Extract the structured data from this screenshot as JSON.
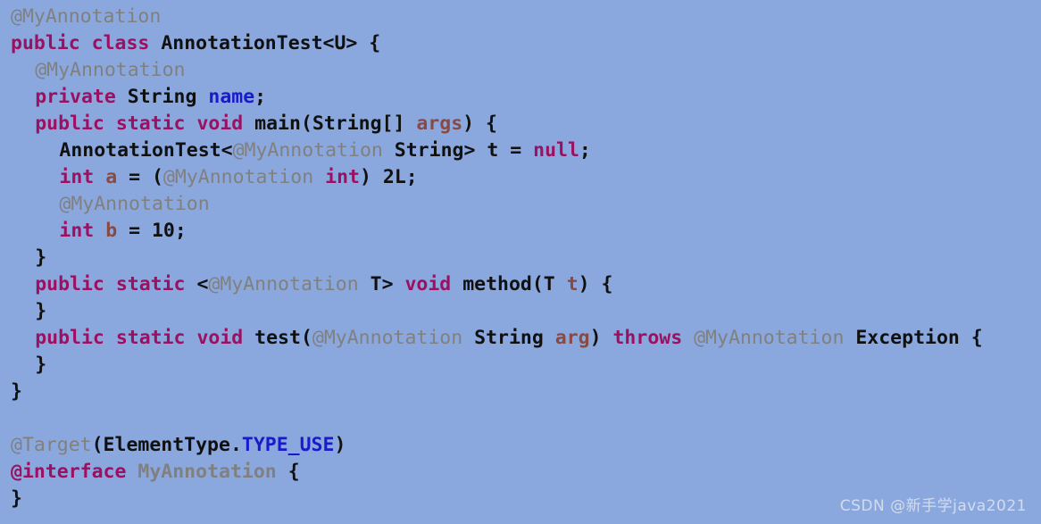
{
  "editor": {
    "background_color": "#8aa8dd",
    "language": "Java",
    "colors": {
      "keyword": "#9b1060",
      "annotation": "#808080",
      "field": "#1a1acc",
      "parameter": "#8a4a44",
      "text": "#101010",
      "constant": "#1a1acc"
    },
    "lines": [
      {
        "indent": 0,
        "tokens": [
          {
            "t": "@MyAnnotation",
            "c": "ann"
          }
        ]
      },
      {
        "indent": 0,
        "tokens": [
          {
            "t": "public",
            "c": "kw"
          },
          {
            "t": " ",
            "c": "plain"
          },
          {
            "t": "class",
            "c": "kw"
          },
          {
            "t": " ",
            "c": "plain"
          },
          {
            "t": "AnnotationTest<U> {",
            "c": "plain"
          }
        ]
      },
      {
        "indent": 1,
        "tokens": [
          {
            "t": "@MyAnnotation",
            "c": "ann"
          }
        ]
      },
      {
        "indent": 1,
        "tokens": [
          {
            "t": "private",
            "c": "kw"
          },
          {
            "t": " ",
            "c": "plain"
          },
          {
            "t": "String",
            "c": "plain"
          },
          {
            "t": " ",
            "c": "plain"
          },
          {
            "t": "name",
            "c": "field"
          },
          {
            "t": ";",
            "c": "plain"
          }
        ]
      },
      {
        "indent": 1,
        "tokens": [
          {
            "t": "public",
            "c": "kw"
          },
          {
            "t": " ",
            "c": "plain"
          },
          {
            "t": "static",
            "c": "kw"
          },
          {
            "t": " ",
            "c": "plain"
          },
          {
            "t": "void",
            "c": "kw"
          },
          {
            "t": " ",
            "c": "plain"
          },
          {
            "t": "main(String[] ",
            "c": "plain"
          },
          {
            "t": "args",
            "c": "param"
          },
          {
            "t": ") {",
            "c": "plain"
          }
        ]
      },
      {
        "indent": 2,
        "tokens": [
          {
            "t": "AnnotationTest<",
            "c": "plain"
          },
          {
            "t": "@MyAnnotation",
            "c": "ann"
          },
          {
            "t": " ",
            "c": "plain"
          },
          {
            "t": "String> t = ",
            "c": "plain"
          },
          {
            "t": "null",
            "c": "kw"
          },
          {
            "t": ";",
            "c": "plain"
          }
        ]
      },
      {
        "indent": 2,
        "tokens": [
          {
            "t": "int",
            "c": "kw"
          },
          {
            "t": " ",
            "c": "plain"
          },
          {
            "t": "a",
            "c": "param"
          },
          {
            "t": " = (",
            "c": "plain"
          },
          {
            "t": "@MyAnnotation",
            "c": "ann"
          },
          {
            "t": " ",
            "c": "plain"
          },
          {
            "t": "int",
            "c": "kw"
          },
          {
            "t": ") ",
            "c": "plain"
          },
          {
            "t": "2L",
            "c": "num"
          },
          {
            "t": ";",
            "c": "plain"
          }
        ]
      },
      {
        "indent": 2,
        "tokens": [
          {
            "t": "@MyAnnotation",
            "c": "ann"
          }
        ]
      },
      {
        "indent": 2,
        "tokens": [
          {
            "t": "int",
            "c": "kw"
          },
          {
            "t": " ",
            "c": "plain"
          },
          {
            "t": "b",
            "c": "param"
          },
          {
            "t": " = ",
            "c": "plain"
          },
          {
            "t": "10",
            "c": "num"
          },
          {
            "t": ";",
            "c": "plain"
          }
        ]
      },
      {
        "indent": 1,
        "tokens": [
          {
            "t": "}",
            "c": "plain"
          }
        ]
      },
      {
        "indent": 1,
        "tokens": [
          {
            "t": "public",
            "c": "kw"
          },
          {
            "t": " ",
            "c": "plain"
          },
          {
            "t": "static",
            "c": "kw"
          },
          {
            "t": " ",
            "c": "plain"
          },
          {
            "t": "<",
            "c": "plain"
          },
          {
            "t": "@MyAnnotation",
            "c": "ann"
          },
          {
            "t": " ",
            "c": "plain"
          },
          {
            "t": "T> ",
            "c": "plain"
          },
          {
            "t": "void",
            "c": "kw"
          },
          {
            "t": " ",
            "c": "plain"
          },
          {
            "t": "method(T ",
            "c": "plain"
          },
          {
            "t": "t",
            "c": "param"
          },
          {
            "t": ") {",
            "c": "plain"
          }
        ]
      },
      {
        "indent": 1,
        "tokens": [
          {
            "t": "}",
            "c": "plain"
          }
        ]
      },
      {
        "indent": 1,
        "tokens": [
          {
            "t": "public",
            "c": "kw"
          },
          {
            "t": " ",
            "c": "plain"
          },
          {
            "t": "static",
            "c": "kw"
          },
          {
            "t": " ",
            "c": "plain"
          },
          {
            "t": "void",
            "c": "kw"
          },
          {
            "t": " ",
            "c": "plain"
          },
          {
            "t": "test(",
            "c": "plain"
          },
          {
            "t": "@MyAnnotation",
            "c": "ann"
          },
          {
            "t": " ",
            "c": "plain"
          },
          {
            "t": "String ",
            "c": "plain"
          },
          {
            "t": "arg",
            "c": "param"
          },
          {
            "t": ") ",
            "c": "plain"
          },
          {
            "t": "throws",
            "c": "kw"
          },
          {
            "t": " ",
            "c": "plain"
          },
          {
            "t": "@MyAnnotation",
            "c": "ann"
          },
          {
            "t": " ",
            "c": "plain"
          },
          {
            "t": "Exception {",
            "c": "plain"
          }
        ]
      },
      {
        "indent": 1,
        "tokens": [
          {
            "t": "}",
            "c": "plain"
          }
        ]
      },
      {
        "indent": 0,
        "tokens": [
          {
            "t": "}",
            "c": "plain"
          }
        ]
      },
      {
        "indent": 0,
        "tokens": []
      },
      {
        "indent": 0,
        "tokens": [
          {
            "t": "@Target",
            "c": "ann"
          },
          {
            "t": "(ElementType.",
            "c": "plain"
          },
          {
            "t": "TYPE_USE",
            "c": "const"
          },
          {
            "t": ")",
            "c": "plain"
          }
        ]
      },
      {
        "indent": 0,
        "tokens": [
          {
            "t": "@interface",
            "c": "kw"
          },
          {
            "t": " ",
            "c": "plain"
          },
          {
            "t": "MyAnnotation",
            "c": "annname"
          },
          {
            "t": " ",
            "c": "plain"
          },
          {
            "t": "{",
            "c": "plain"
          }
        ]
      },
      {
        "indent": 0,
        "tokens": [
          {
            "t": "}",
            "c": "plain"
          }
        ]
      }
    ]
  },
  "watermark": {
    "text": "CSDN @新手学java2021"
  }
}
